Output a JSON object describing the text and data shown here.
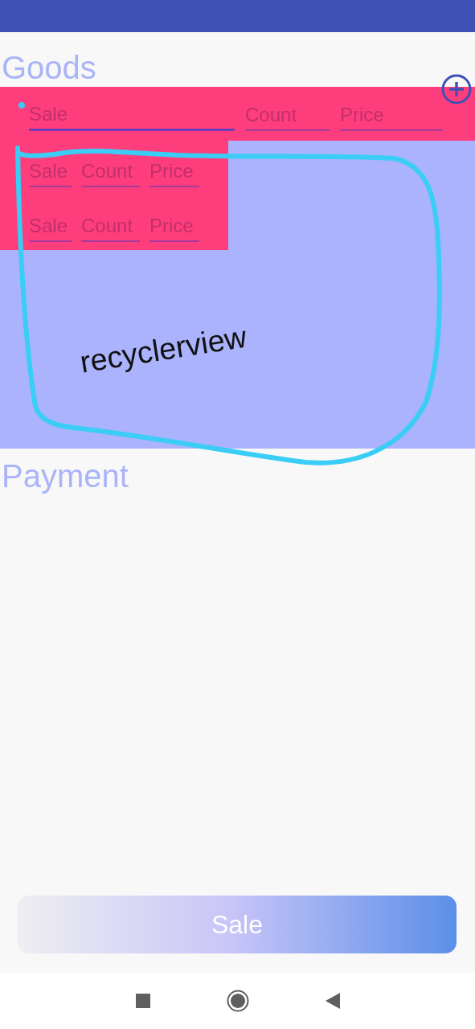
{
  "goods": {
    "title": "Goods",
    "header_fields": [
      {
        "placeholder": "Sale",
        "focused": true
      },
      {
        "placeholder": "Count",
        "focused": false
      },
      {
        "placeholder": "Price",
        "focused": false
      }
    ],
    "rows": [
      {
        "fields": [
          {
            "placeholder": "Sale"
          },
          {
            "placeholder": "Count"
          },
          {
            "placeholder": "Price"
          }
        ]
      },
      {
        "fields": [
          {
            "placeholder": "Sale"
          },
          {
            "placeholder": "Count"
          },
          {
            "placeholder": "Price"
          }
        ]
      }
    ]
  },
  "annotation": {
    "label": "recyclerview"
  },
  "payment": {
    "title": "Payment"
  },
  "sale_button": {
    "label": "Sale"
  }
}
